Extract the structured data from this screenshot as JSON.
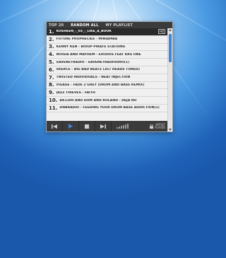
{
  "tabs": [
    {
      "label": "TOP 20"
    },
    {
      "label": "RANDOM ALL"
    },
    {
      "label": "MY PLAYLIST"
    }
  ],
  "playlist": [
    {
      "number": "1.",
      "title": "KOSHEEN_-_03_-_LIKE_A_BOOK",
      "badge": "HQ"
    },
    {
      "number": "2.",
      "title": "FUTURE PROPHECIES - MINIAMBA"
    },
    {
      "number": "3.",
      "title": "KENNY KEN - BIOUP PIRATE STATIONS"
    },
    {
      "number": "4.",
      "title": "NOISIA AND MAYHEM - EXODUS FEAT KRS ONE"
    },
    {
      "number": "5.",
      "title": "SAVENETRADIO - SAVENETRADIODRO(1)"
    },
    {
      "number": "6.",
      "title": "SKERCE - BIG BAD BEATZ (267 HEADS TUNED)"
    },
    {
      "number": "7.",
      "title": "TWISTED INDIVIDUALS - NEAT INJECTION"
    },
    {
      "number": "8.",
      "title": "VISAGE - FADE 2 GREY (DRUM AND BASS REMIX)"
    },
    {
      "number": "9.",
      "title": "JAZZ THIEVES - FAITH"
    },
    {
      "number": "10.",
      "title": "AK1200 AND DOM AND ROLAND - DEJA NU"
    },
    {
      "number": "11.",
      "title": "DNBRADIO - FEEDING YOUR DRUM BASS ADDICTION(1)"
    }
  ],
  "controls": {
    "icons": [
      "skip-back-icon",
      "play-icon",
      "stop-icon",
      "skip-forward-icon",
      "volume-icon"
    ],
    "brand_line1": "ARTIST",
    "brand_line2": "PLAYER"
  },
  "colors": {
    "accent": "#3d86e0",
    "selected_row": "#2a2a2a",
    "toolbar": "#3b3b3b"
  }
}
